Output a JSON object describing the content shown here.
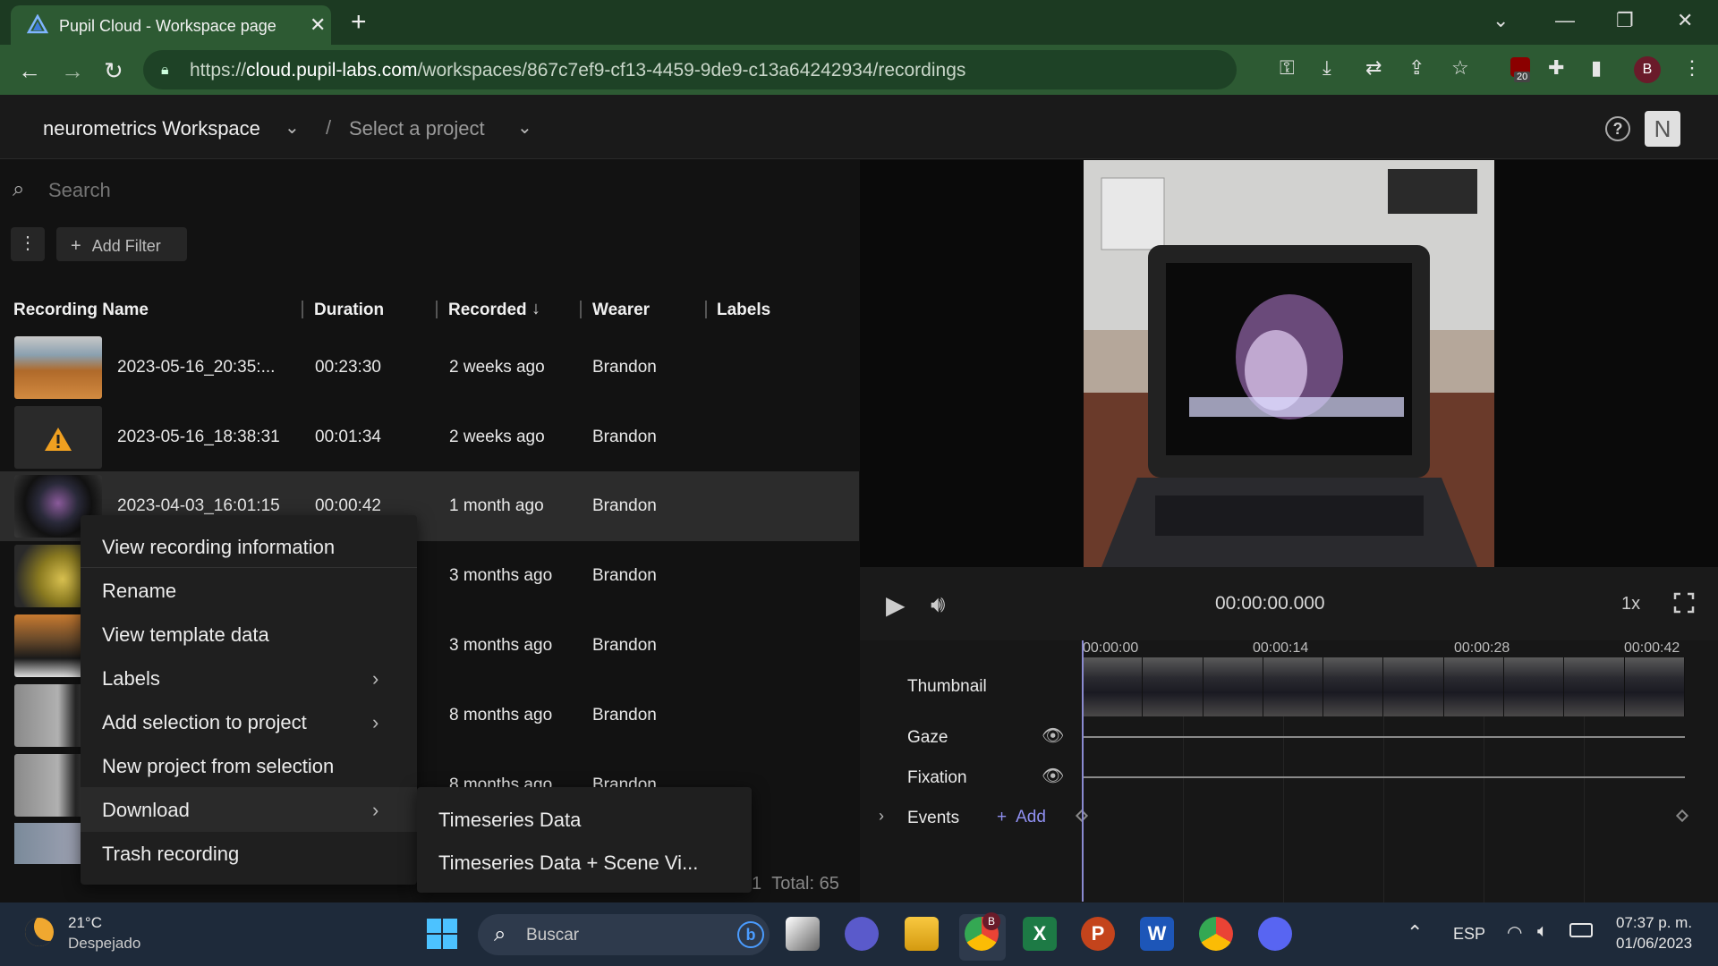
{
  "browser": {
    "tab_title": "Pupil Cloud - Workspace page",
    "url_host": "cloud.pupil-labs.com",
    "url_prefix": "https://",
    "url_path": "/workspaces/867c7ef9-cf13-4459-9de9-c13a64242934/recordings",
    "profile_initial": "B",
    "extension_badge": "20"
  },
  "header": {
    "workspace": "neurometrics Workspace",
    "separator": "/",
    "project_placeholder": "Select a project",
    "user_initial": "N",
    "help": "?"
  },
  "toolbar": {
    "search_placeholder": "Search",
    "add_filter": "Add Filter"
  },
  "table": {
    "columns": [
      "Recording Name",
      "Duration",
      "Recorded",
      "Wearer",
      "Labels"
    ],
    "rows": [
      {
        "name": "2023-05-16_20:35:...",
        "duration": "00:23:30",
        "recorded": "2 weeks ago",
        "wearer": "Brandon"
      },
      {
        "name": "2023-05-16_18:38:31",
        "duration": "00:01:34",
        "recorded": "2 weeks ago",
        "wearer": "Brandon"
      },
      {
        "name": "2023-04-03_16:01:15",
        "duration": "00:00:42",
        "recorded": "1 month ago",
        "wearer": "Brandon"
      },
      {
        "name": "",
        "duration": "",
        "recorded": "3 months ago",
        "wearer": "Brandon"
      },
      {
        "name": "",
        "duration": "",
        "recorded": "3 months ago",
        "wearer": "Brandon"
      },
      {
        "name": "",
        "duration": "",
        "recorded": "8 months ago",
        "wearer": "Brandon"
      },
      {
        "name": "",
        "duration": "",
        "recorded": "8 months ago",
        "wearer": "Brandon"
      }
    ],
    "footer_page": "1",
    "footer_total": "Total: 65"
  },
  "context_menu": {
    "items": [
      "View recording information",
      "Rename",
      "View template data",
      "Labels",
      "Add selection to project",
      "New project from selection",
      "Download",
      "Trash recording"
    ],
    "download_submenu": [
      "Timeseries Data",
      "Timeseries Data + Scene Vi..."
    ]
  },
  "player": {
    "timecode": "00:00:00.000",
    "speed": "1x",
    "timeline_labels": [
      "00:00:00",
      "00:00:14",
      "00:00:28",
      "00:00:42"
    ],
    "tracks": [
      "Thumbnail",
      "Gaze",
      "Fixation",
      "Events"
    ],
    "add_event": "Add"
  },
  "taskbar": {
    "weather_temp": "21°C",
    "weather_desc": "Despejado",
    "search_placeholder": "Buscar",
    "language": "ESP",
    "time": "07:37 p. m.",
    "date": "01/06/2023",
    "chrome_badge": "B"
  }
}
